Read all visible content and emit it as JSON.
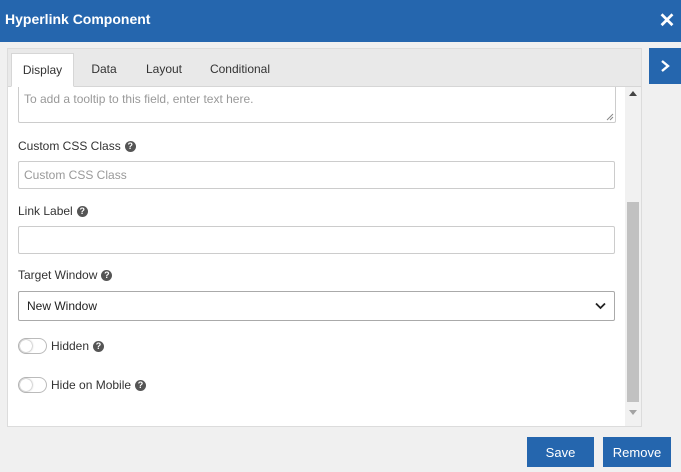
{
  "dialog": {
    "title": "Hyperlink Component",
    "close_label": "✕"
  },
  "tabs": [
    {
      "label": "Display",
      "active": true
    },
    {
      "label": "Data",
      "active": false
    },
    {
      "label": "Layout",
      "active": false
    },
    {
      "label": "Conditional",
      "active": false
    }
  ],
  "fields": {
    "tooltip": {
      "placeholder": "To add a tooltip to this field, enter text here."
    },
    "custom_css": {
      "label": "Custom CSS Class",
      "placeholder": "Custom CSS Class",
      "value": ""
    },
    "link_label": {
      "label": "Link Label",
      "value": ""
    },
    "target_window": {
      "label": "Target Window",
      "value": "New Window"
    },
    "hidden": {
      "label": "Hidden",
      "on": false
    },
    "hide_on_mobile": {
      "label": "Hide on Mobile",
      "on": false
    }
  },
  "help_glyph": "?",
  "buttons": {
    "save": "Save",
    "remove": "Remove"
  },
  "colors": {
    "primary": "#2566ae"
  }
}
